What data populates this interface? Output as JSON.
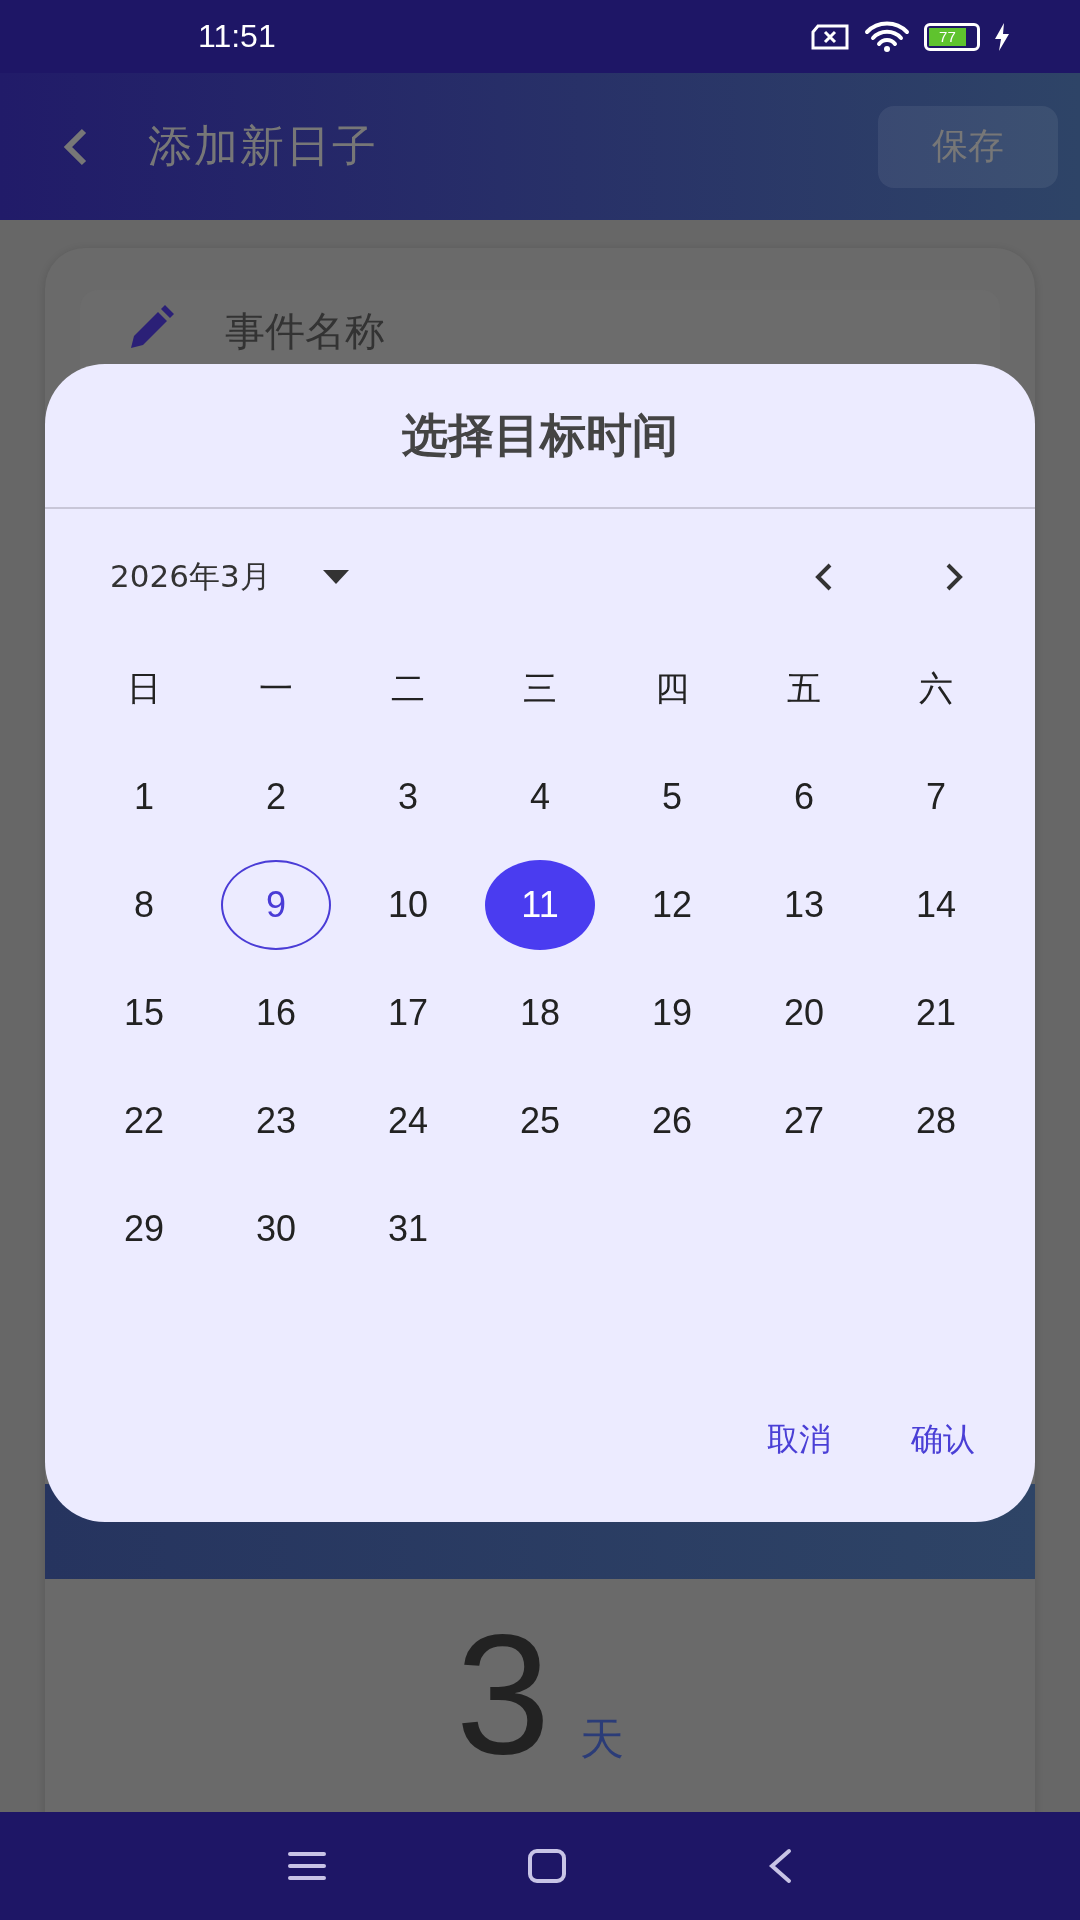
{
  "status_bar": {
    "time": "11:51",
    "battery": "77"
  },
  "app_bar": {
    "title": "添加新日子",
    "save": "保存"
  },
  "form": {
    "name_label": "事件名称",
    "count": "3",
    "unit": "天"
  },
  "dialog": {
    "title": "选择目标时间",
    "month": "2026年3月",
    "weekdays": [
      "日",
      "一",
      "二",
      "三",
      "四",
      "五",
      "六"
    ],
    "days": [
      {
        "label": "1",
        "selected": false,
        "today": false
      },
      {
        "label": "2",
        "selected": false,
        "today": false
      },
      {
        "label": "3",
        "selected": false,
        "today": false
      },
      {
        "label": "4",
        "selected": false,
        "today": false
      },
      {
        "label": "5",
        "selected": false,
        "today": false
      },
      {
        "label": "6",
        "selected": false,
        "today": false
      },
      {
        "label": "7",
        "selected": false,
        "today": false
      },
      {
        "label": "8",
        "selected": false,
        "today": false
      },
      {
        "label": "9",
        "selected": false,
        "today": true
      },
      {
        "label": "10",
        "selected": false,
        "today": false
      },
      {
        "label": "11",
        "selected": true,
        "today": false
      },
      {
        "label": "12",
        "selected": false,
        "today": false
      },
      {
        "label": "13",
        "selected": false,
        "today": false
      },
      {
        "label": "14",
        "selected": false,
        "today": false
      },
      {
        "label": "15",
        "selected": false,
        "today": false
      },
      {
        "label": "16",
        "selected": false,
        "today": false
      },
      {
        "label": "17",
        "selected": false,
        "today": false
      },
      {
        "label": "18",
        "selected": false,
        "today": false
      },
      {
        "label": "19",
        "selected": false,
        "today": false
      },
      {
        "label": "20",
        "selected": false,
        "today": false
      },
      {
        "label": "21",
        "selected": false,
        "today": false
      },
      {
        "label": "22",
        "selected": false,
        "today": false
      },
      {
        "label": "23",
        "selected": false,
        "today": false
      },
      {
        "label": "24",
        "selected": false,
        "today": false
      },
      {
        "label": "25",
        "selected": false,
        "today": false
      },
      {
        "label": "26",
        "selected": false,
        "today": false
      },
      {
        "label": "27",
        "selected": false,
        "today": false
      },
      {
        "label": "28",
        "selected": false,
        "today": false
      },
      {
        "label": "29",
        "selected": false,
        "today": false
      },
      {
        "label": "30",
        "selected": false,
        "today": false
      },
      {
        "label": "31",
        "selected": false,
        "today": false
      }
    ],
    "buttons": [
      "取消",
      "确认"
    ]
  }
}
